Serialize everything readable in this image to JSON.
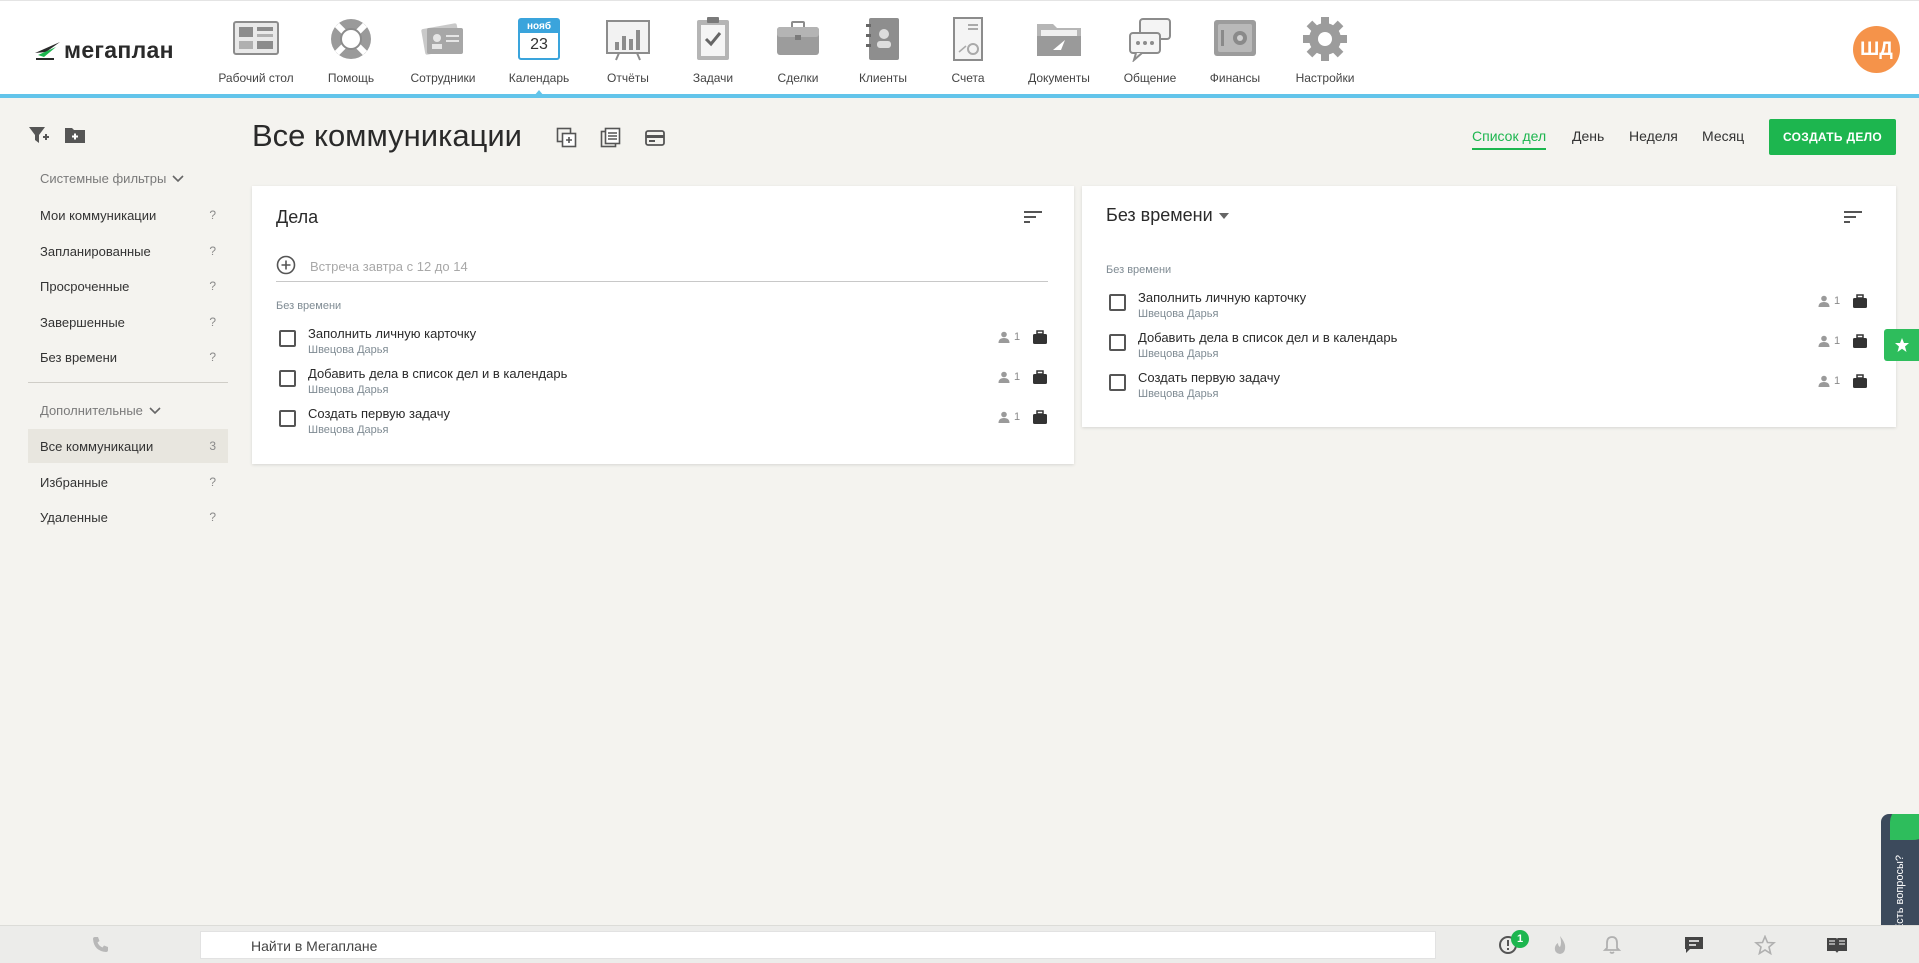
{
  "app": {
    "logo_text": "мегаплан",
    "user_initials": "ШД",
    "accent_color": "#1db64f",
    "topbar_accent": "#62c4ea",
    "avatar_color": "#f5934a"
  },
  "nav": {
    "items": [
      {
        "label": "Рабочий стол",
        "icon": "desktop-icon"
      },
      {
        "label": "Помощь",
        "icon": "lifebuoy-icon"
      },
      {
        "label": "Сотрудники",
        "icon": "id-cards-icon"
      },
      {
        "label": "Календарь",
        "icon": "calendar-icon",
        "month": "нояб",
        "day": "23"
      },
      {
        "label": "Отчёты",
        "icon": "report-chart-icon"
      },
      {
        "label": "Задачи",
        "icon": "clipboard-check-icon"
      },
      {
        "label": "Сделки",
        "icon": "briefcase-icon"
      },
      {
        "label": "Клиенты",
        "icon": "address-book-icon"
      },
      {
        "label": "Счета",
        "icon": "invoice-icon"
      },
      {
        "label": "Документы",
        "icon": "folder-icon"
      },
      {
        "label": "Общение",
        "icon": "chat-bubbles-icon"
      },
      {
        "label": "Финансы",
        "icon": "safe-icon"
      },
      {
        "label": "Настройки",
        "icon": "gear-icon"
      }
    ]
  },
  "sidebar": {
    "system_filters_title": "Системные фильтры",
    "system_items": [
      {
        "label": "Мои коммуникации",
        "count": "?"
      },
      {
        "label": "Запланированные",
        "count": "?"
      },
      {
        "label": "Просроченные",
        "count": "?"
      },
      {
        "label": "Завершенные",
        "count": "?"
      },
      {
        "label": "Без времени",
        "count": "?"
      }
    ],
    "extra_title": "Дополнительные",
    "extra_items": [
      {
        "label": "Все коммуникации",
        "count": "3"
      },
      {
        "label": "Избранные",
        "count": "?"
      },
      {
        "label": "Удаленные",
        "count": "?"
      }
    ]
  },
  "header": {
    "title": "Все коммуникации",
    "views": [
      "Список дел",
      "День",
      "Неделя",
      "Месяц"
    ],
    "active_view": "Список дел",
    "create_button": "СОЗДАТЬ ДЕЛО"
  },
  "left_card": {
    "title": "Дела",
    "add_placeholder": "Встреча завтра с 12 до 14",
    "group_label": "Без времени",
    "tasks": [
      {
        "name": "Заполнить личную карточку",
        "owner": "Швецова Дарья",
        "people": "1"
      },
      {
        "name": "Добавить дела в список дел и в календарь",
        "owner": "Швецова Дарья",
        "people": "1"
      },
      {
        "name": "Создать первую задачу",
        "owner": "Швецова Дарья",
        "people": "1"
      }
    ]
  },
  "right_card": {
    "title": "Без времени",
    "group_label": "Без времени",
    "tasks": [
      {
        "name": "Заполнить личную карточку",
        "owner": "Швецова Дарья",
        "people": "1"
      },
      {
        "name": "Добавить дела в список дел и в календарь",
        "owner": "Швецова Дарья",
        "people": "1"
      },
      {
        "name": "Создать первую задачу",
        "owner": "Швецова Дарья",
        "people": "1"
      }
    ]
  },
  "help_widget": {
    "label": "Есть вопросы?"
  },
  "bottombar": {
    "search_placeholder": "Найти в Мегаплане",
    "alerts_badge": "1"
  }
}
